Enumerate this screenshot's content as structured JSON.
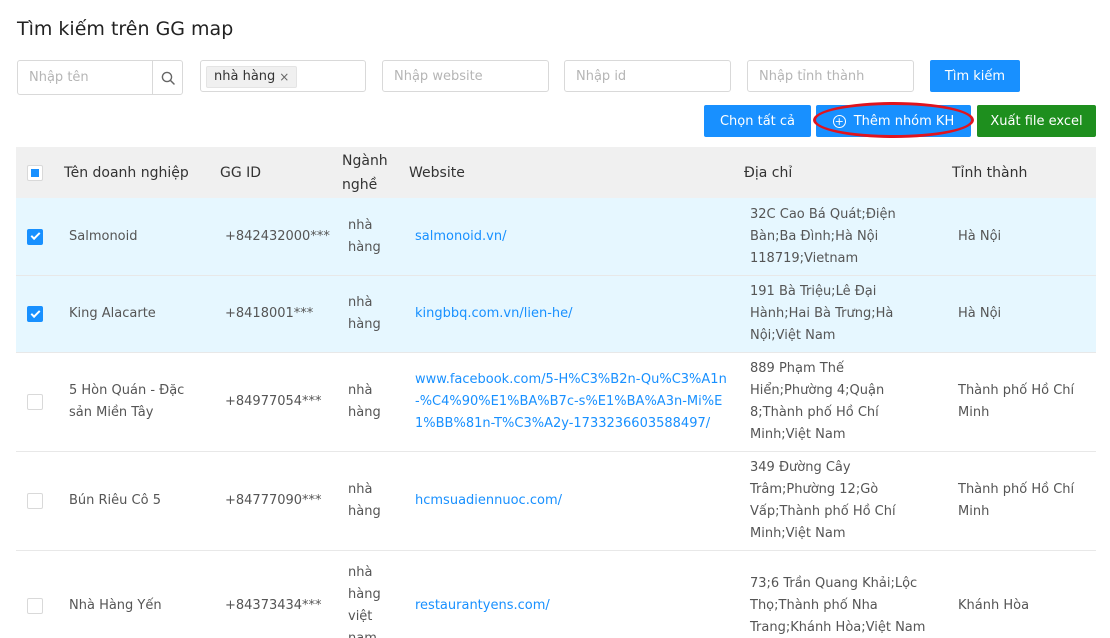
{
  "title": "Tìm kiếm trên GG map",
  "filters": {
    "name_placeholder": "Nhập tên",
    "industry_tag": "nhà hàng",
    "tag_close": "×",
    "website_placeholder": "Nhập website",
    "id_placeholder": "Nhập id",
    "province_placeholder": "Nhập tỉnh thành",
    "search_label": "Tìm kiếm"
  },
  "actions": {
    "select_all": "Chọn tất cả",
    "add_group": "Thêm nhóm KH",
    "add_group_icon": "+",
    "export": "Xuất file excel"
  },
  "colors": {
    "primary": "#1890ff",
    "export": "#1e8f1e",
    "highlight": "#e0141e",
    "selected_row": "#e6f7ff"
  },
  "table": {
    "headers": {
      "name": "Tên doanh nghiệp",
      "gg_id": "GG ID",
      "industry": "Ngành nghề",
      "website": "Website",
      "address": "Địa chỉ",
      "province": "Tỉnh thành"
    },
    "rows": [
      {
        "checked": true,
        "name": "Salmonoid",
        "gg_id": "+842432000***",
        "industry": "nhà hàng",
        "website": "salmonoid.vn/",
        "address": "32C Cao Bá Quát;Điện Bàn;Ba Đình;Hà Nội 118719;Vietnam",
        "province": "Hà Nội"
      },
      {
        "checked": true,
        "name": "King Alacarte",
        "gg_id": "+8418001***",
        "industry": "nhà hàng",
        "website": "kingbbq.com.vn/lien-he/",
        "address": "191 Bà Triệu;Lê Đại Hành;Hai Bà Trưng;Hà Nội;Việt Nam",
        "province": "Hà Nội"
      },
      {
        "checked": false,
        "name": "5 Hòn Quán - Đặc sản Miền Tây",
        "gg_id": "+84977054***",
        "industry": "nhà hàng",
        "website": "www.facebook.com/5-H%C3%B2n-Qu%C3%A1n-%C4%90%E1%BA%B7c-s%E1%BA%A3n-Mi%E1%BB%81n-T%C3%A2y-1733236603588497/",
        "address": "889 Phạm Thế Hiển;Phường 4;Quận 8;Thành phố Hồ Chí Minh;Việt Nam",
        "province": "Thành phố Hồ Chí Minh"
      },
      {
        "checked": false,
        "name": "Bún Riêu Cô 5",
        "gg_id": "+84777090***",
        "industry": "nhà hàng",
        "website": "hcmsuadiennuoc.com/",
        "address": "349 Đường Cây Trâm;Phường 12;Gò Vấp;Thành phố Hồ Chí Minh;Việt Nam",
        "province": "Thành phố Hồ Chí Minh"
      },
      {
        "checked": false,
        "name": "Nhà Hàng Yến",
        "gg_id": "+84373434***",
        "industry": "nhà hàng việt nam",
        "website": "restaurantyens.com/",
        "address": "73;6 Trần Quang Khải;Lộc Thọ;Thành phố Nha Trang;Khánh Hòa;Việt Nam",
        "province": "Khánh Hòa"
      }
    ]
  }
}
